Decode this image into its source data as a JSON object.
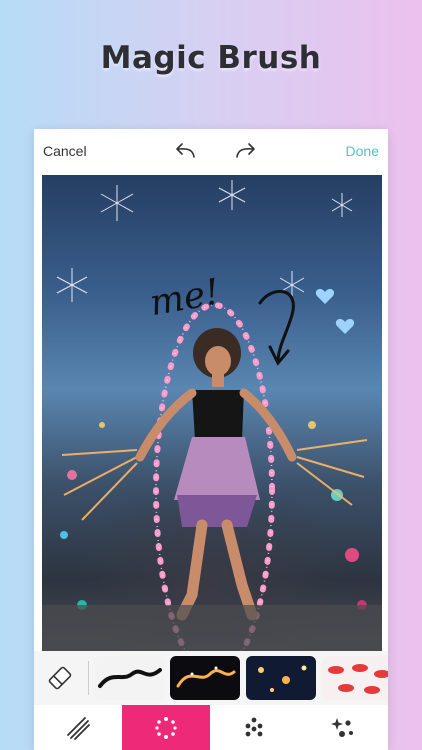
{
  "headline": "Magic Brush",
  "topbar": {
    "cancel_label": "Cancel",
    "done_label": "Done",
    "undo_icon": "undo-arrow-icon",
    "redo_icon": "redo-arrow-icon"
  },
  "canvas": {
    "annotation_text": "me!"
  },
  "brushbar": {
    "items": [
      "eraser-icon",
      "marker-brush",
      "sparkle-brush",
      "bokeh-brush",
      "lips-brush"
    ]
  },
  "tabbar": {
    "active_index": 1,
    "tabs": [
      "brush-strokes-icon",
      "magic-ring-icon",
      "dots-icon",
      "sparkle-dots-icon"
    ]
  },
  "colors": {
    "done": "#4fc6c0",
    "active_tab": "#ee2a78",
    "headline": "#2e2e35"
  }
}
